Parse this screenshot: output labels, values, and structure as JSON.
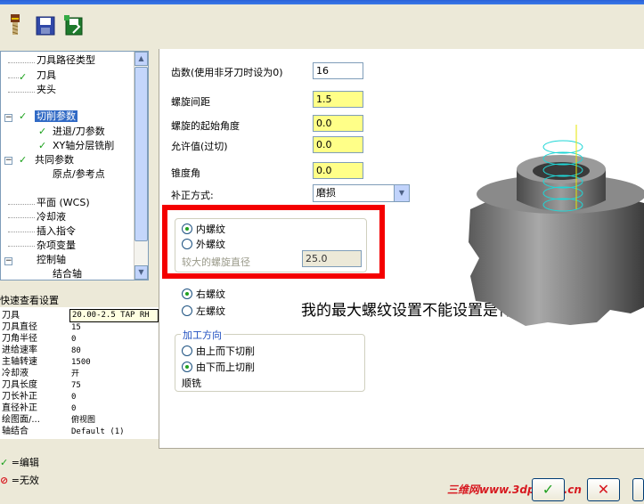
{
  "tree": {
    "items": [
      {
        "label": "刀具路径类型",
        "check": false
      },
      {
        "label": "刀具",
        "check": true
      },
      {
        "label": "夹头",
        "check": false
      },
      {
        "label": "切削参数",
        "check": true,
        "selected": true
      },
      {
        "label": "进退/刀参数",
        "check": true
      },
      {
        "label": "XY轴分层铣削",
        "check": true
      },
      {
        "label": "共同参数",
        "check": true
      },
      {
        "label": "原点/参考点",
        "check": false
      },
      {
        "label": "平面 (WCS)",
        "check": false
      },
      {
        "label": "冷却液",
        "check": false
      },
      {
        "label": "插入指令",
        "check": false
      },
      {
        "label": "杂项变量",
        "check": false
      },
      {
        "label": "控制轴",
        "check": false
      },
      {
        "label": "结合轴",
        "check": false
      }
    ]
  },
  "quick_view": {
    "title": "快速查看设置",
    "tooltip": "20.00-2.5 TAP RH",
    "rows": [
      {
        "key": "刀具",
        "value": ""
      },
      {
        "key": "刀具直径",
        "value": "15"
      },
      {
        "key": "刀角半径",
        "value": "0"
      },
      {
        "key": "进给速率",
        "value": "80"
      },
      {
        "key": "主轴转速",
        "value": "1500"
      },
      {
        "key": "冷却液",
        "value": "开"
      },
      {
        "key": "刀具长度",
        "value": "75"
      },
      {
        "key": "刀长补正",
        "value": "0"
      },
      {
        "key": "直径补正",
        "value": "0"
      },
      {
        "key": "绘图面/...",
        "value": "俯视图"
      },
      {
        "key": "轴结合",
        "value": "Default (1)"
      }
    ]
  },
  "legend": {
    "edit": "=编辑",
    "invalid": "=无效"
  },
  "form": {
    "teeth_label": "齿数(使用非牙刀时设为0)",
    "teeth_value": "16",
    "pitch_label": "螺旋间距",
    "pitch_value": "1.5",
    "start_angle_label": "螺旋的起始角度",
    "start_angle_value": "0.0",
    "allowance_label": "允许值(过切)",
    "allowance_value": "0.0",
    "taper_label": "锥度角",
    "taper_value": "0.0",
    "comp_label": "补正方式:",
    "comp_value": "磨损"
  },
  "thread_type": {
    "internal": "内螺纹",
    "external": "外螺纹",
    "major_dia_label": "较大的螺旋直径",
    "major_dia_value": "25.0"
  },
  "hand": {
    "right": "右螺纹",
    "left": "左螺纹"
  },
  "direction": {
    "title": "加工方向",
    "top_down": "由上而下切削",
    "bottom_up": "由下而上切削",
    "mode": "顺铣"
  },
  "annotation": "我的最大螺纹设置不能设置是什么原因",
  "watermark": "三维网www.3dportal.cn",
  "colors": {
    "highlight": "#f40000",
    "required_field": "#ffff88",
    "selection": "#316ac5"
  }
}
